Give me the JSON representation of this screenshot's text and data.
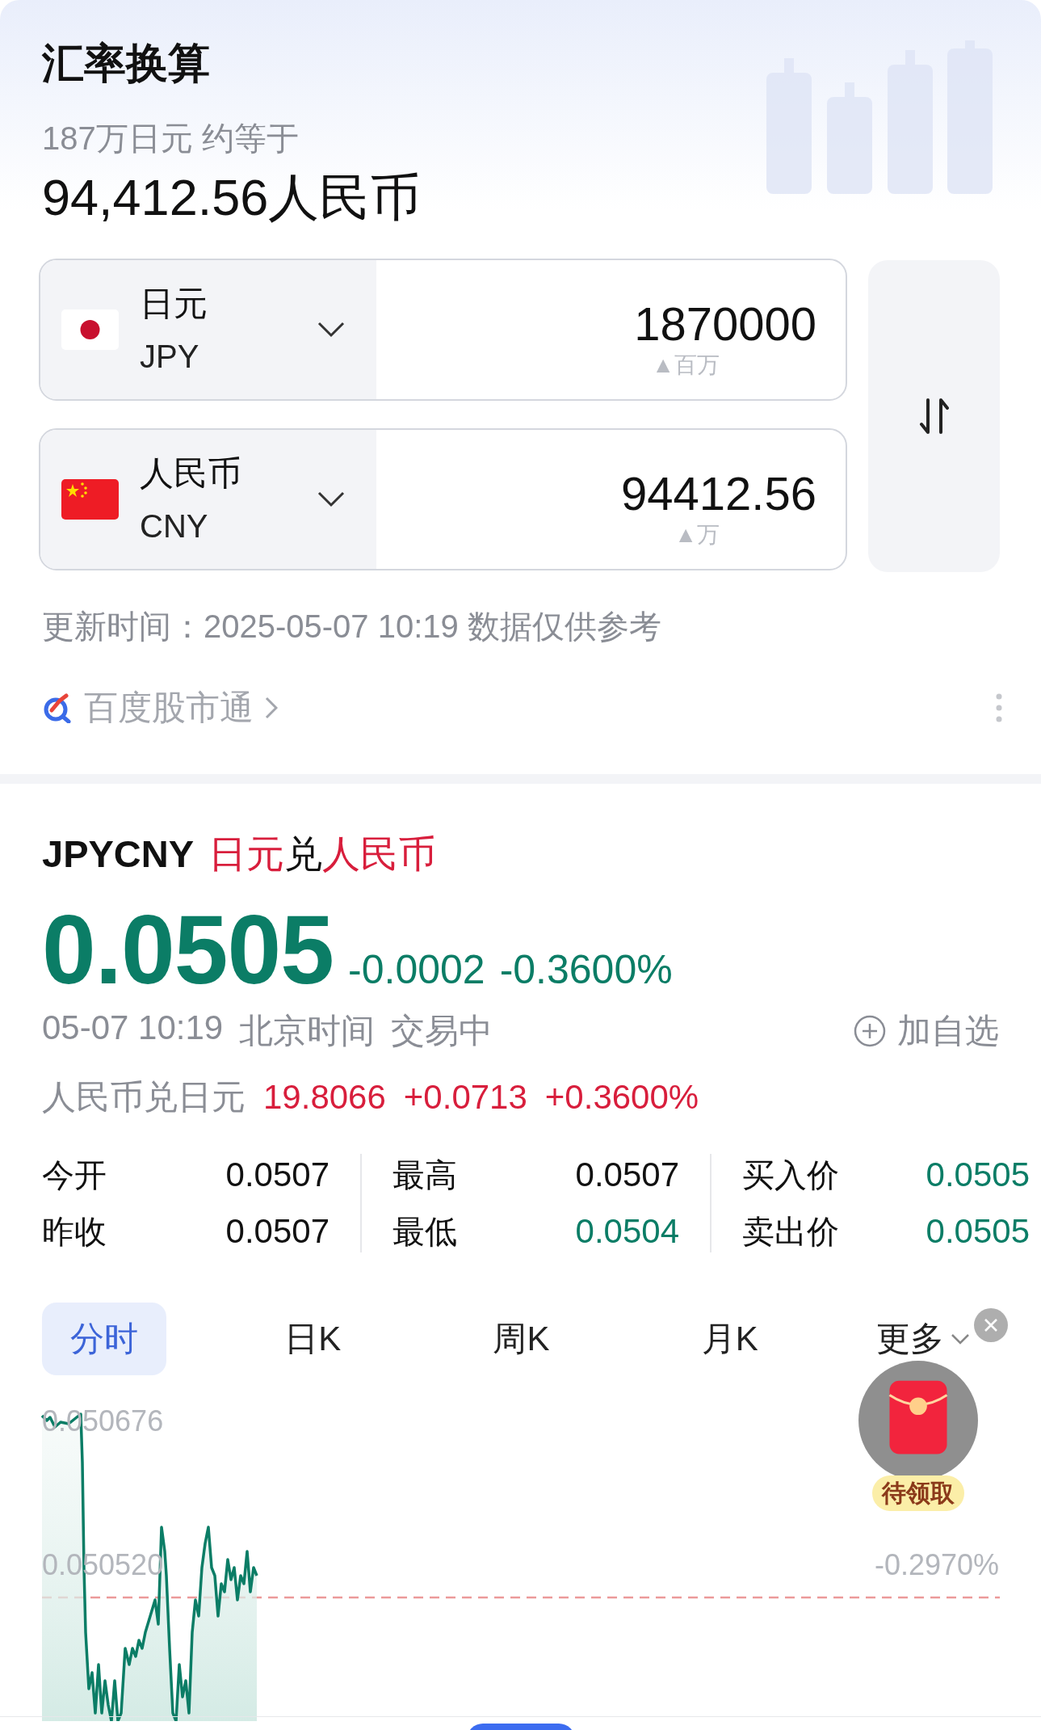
{
  "header": {
    "title": "汇率换算",
    "subtitle": "187万日元 约等于",
    "result": "94,412.56人民币"
  },
  "converter": {
    "rows": [
      {
        "kind": "japan",
        "name": "日元",
        "code": "JPY",
        "amount": "1870000",
        "hint": "▲百万"
      },
      {
        "kind": "china",
        "name": "人民币",
        "code": "CNY",
        "amount": "94412.56",
        "hint": "▲万"
      }
    ]
  },
  "update_note": "更新时间：2025-05-07 10:19 数据仅供参考",
  "source": {
    "label": "百度股市通"
  },
  "quote": {
    "symbol": "JPYCNY",
    "name_parts": [
      {
        "text": "日元",
        "highlight": true
      },
      {
        "text": "兑",
        "highlight": false
      },
      {
        "text": "人民币",
        "highlight": true
      }
    ],
    "price": "0.0505",
    "change": "-0.0002",
    "change_pct": "-0.3600%",
    "color": "#0b7d66",
    "time": "05-07 10:19",
    "zone": "北京时间",
    "status": "交易中",
    "watch_label": "加自选",
    "inverse": {
      "label": "人民币兑日元",
      "price": "19.8066",
      "change": "+0.0713",
      "change_pct": "+0.3600%",
      "color": "#d81e3c"
    }
  },
  "stats": [
    [
      {
        "label": "今开",
        "value": "0.0507",
        "color": "#111111"
      },
      {
        "label": "昨收",
        "value": "0.0507",
        "color": "#111111"
      }
    ],
    [
      {
        "label": "最高",
        "value": "0.0507",
        "color": "#111111"
      },
      {
        "label": "最低",
        "value": "0.0504",
        "color": "#0b7d66"
      }
    ],
    [
      {
        "label": "买入价",
        "value": "0.0505",
        "color": "#0b7d66"
      },
      {
        "label": "卖出价",
        "value": "0.0505",
        "color": "#0b7d66"
      }
    ]
  ],
  "tabs": [
    {
      "label": "分时",
      "selected": true,
      "kind": "plain"
    },
    {
      "label": "日K",
      "selected": false,
      "kind": "plain"
    },
    {
      "label": "周K",
      "selected": false,
      "kind": "plain"
    },
    {
      "label": "月K",
      "selected": false,
      "kind": "plain"
    },
    {
      "label": "更多",
      "selected": false,
      "kind": "dropdown"
    }
  ],
  "chart": {
    "axis_labels": [
      {
        "price": "0.050676"
      },
      {
        "price": "0.050520",
        "percent": "-0.2970%"
      }
    ]
  },
  "promo": {
    "label": "待领取"
  }
}
